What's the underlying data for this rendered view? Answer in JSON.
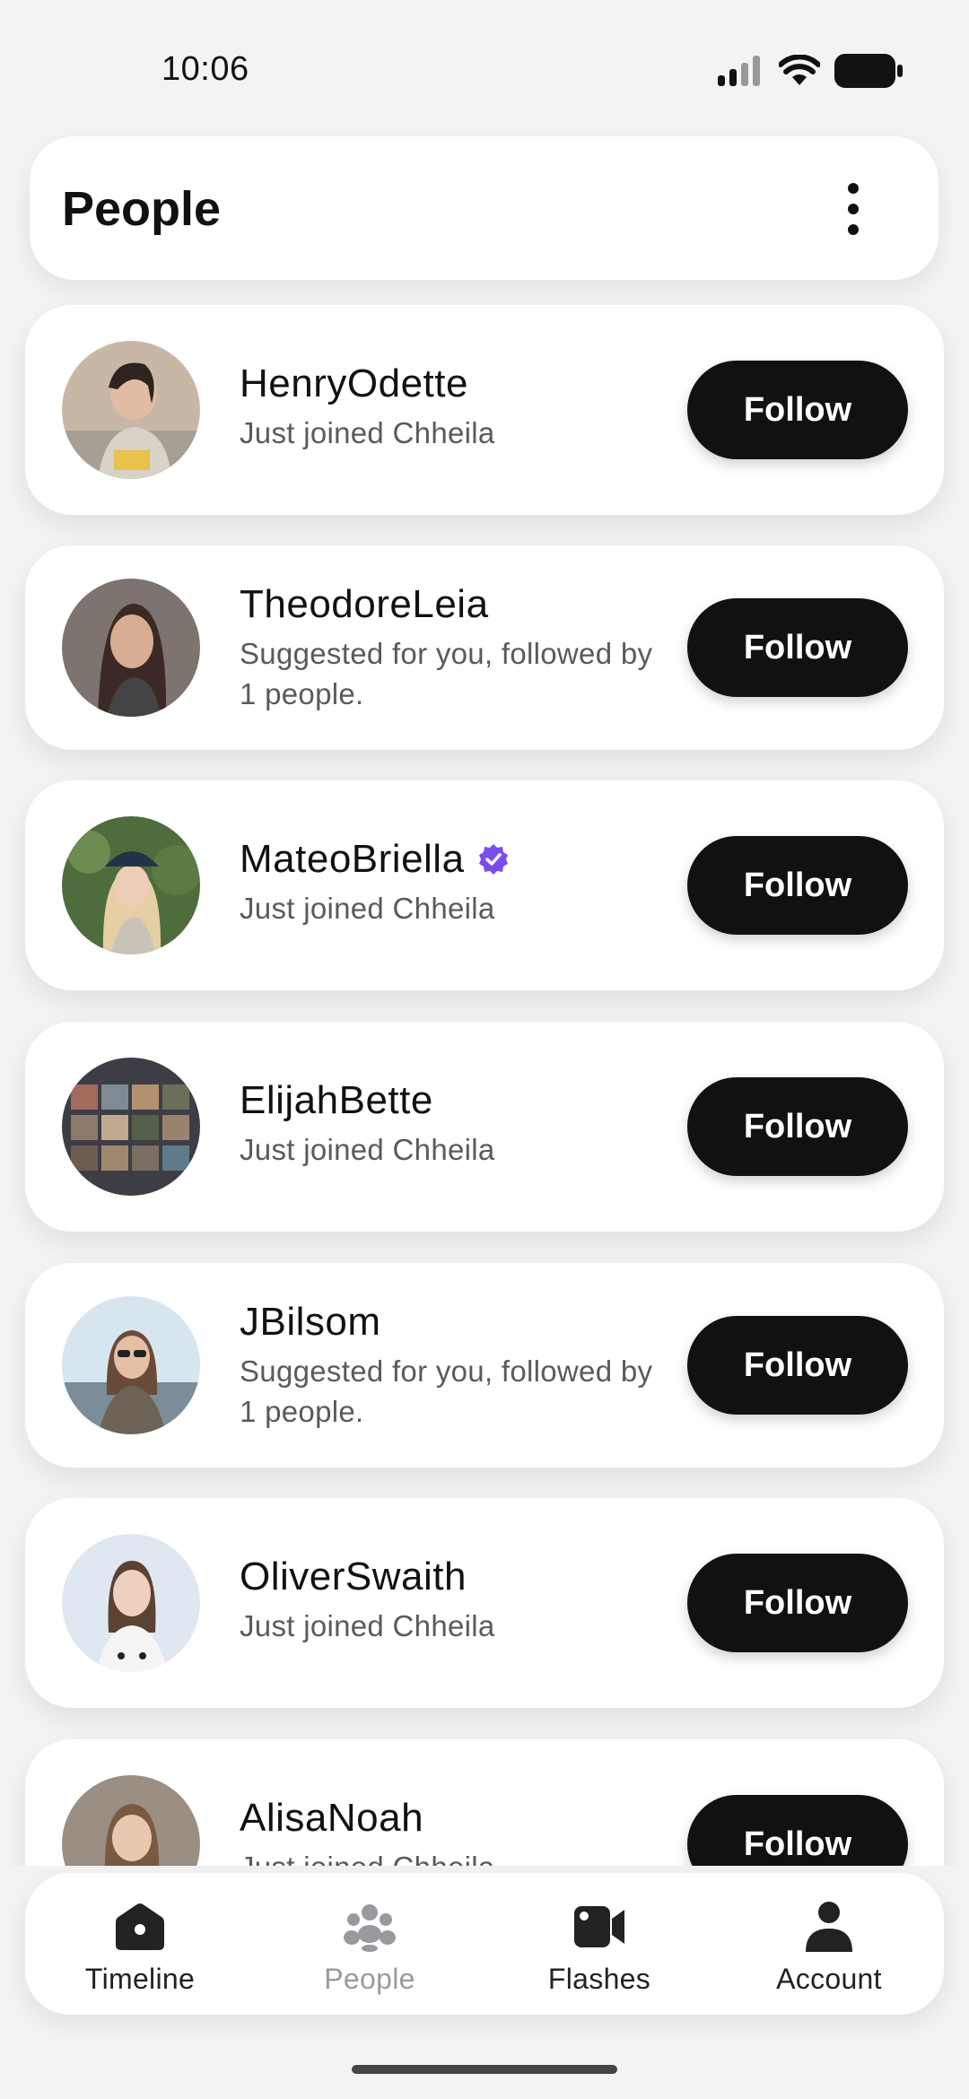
{
  "status_bar": {
    "time": "10:06"
  },
  "header": {
    "title": "People"
  },
  "people": [
    {
      "name": "HenryOdette",
      "subtitle": "Just joined Chheila",
      "verified": false,
      "follow_label": "Follow",
      "avatar_color": "#b9a18e"
    },
    {
      "name": "TheodoreLeia",
      "subtitle": "Suggested for you, followed by 1 people.",
      "verified": false,
      "follow_label": "Follow",
      "avatar_color": "#6f6159"
    },
    {
      "name": "MateoBriella",
      "subtitle": "Just joined Chheila",
      "verified": true,
      "follow_label": "Follow",
      "avatar_color": "#5d7a48"
    },
    {
      "name": "ElijahBette",
      "subtitle": "Just joined Chheila",
      "verified": false,
      "follow_label": "Follow",
      "avatar_color": "#4a4b52"
    },
    {
      "name": "JBilsom",
      "subtitle": "Suggested for you, followed by 1 people.",
      "verified": false,
      "follow_label": "Follow",
      "avatar_color": "#a9b8c2"
    },
    {
      "name": "OliverSwaith",
      "subtitle": "Just joined Chheila",
      "verified": false,
      "follow_label": "Follow",
      "avatar_color": "#cfd9e3"
    },
    {
      "name": "AlisaNoah",
      "subtitle": "Just joined Chheila",
      "verified": false,
      "follow_label": "Follow",
      "avatar_color": "#8a7a6c"
    }
  ],
  "nav": {
    "items": [
      {
        "label": "Timeline",
        "icon": "home-icon",
        "active": true
      },
      {
        "label": "People",
        "icon": "people-icon",
        "active": false
      },
      {
        "label": "Flashes",
        "icon": "video-icon",
        "active": true
      },
      {
        "label": "Account",
        "icon": "account-icon",
        "active": true
      }
    ]
  },
  "colors": {
    "accent_verified": "#7b4df0",
    "button_bg": "#111111",
    "inactive": "#9a9a9e"
  }
}
